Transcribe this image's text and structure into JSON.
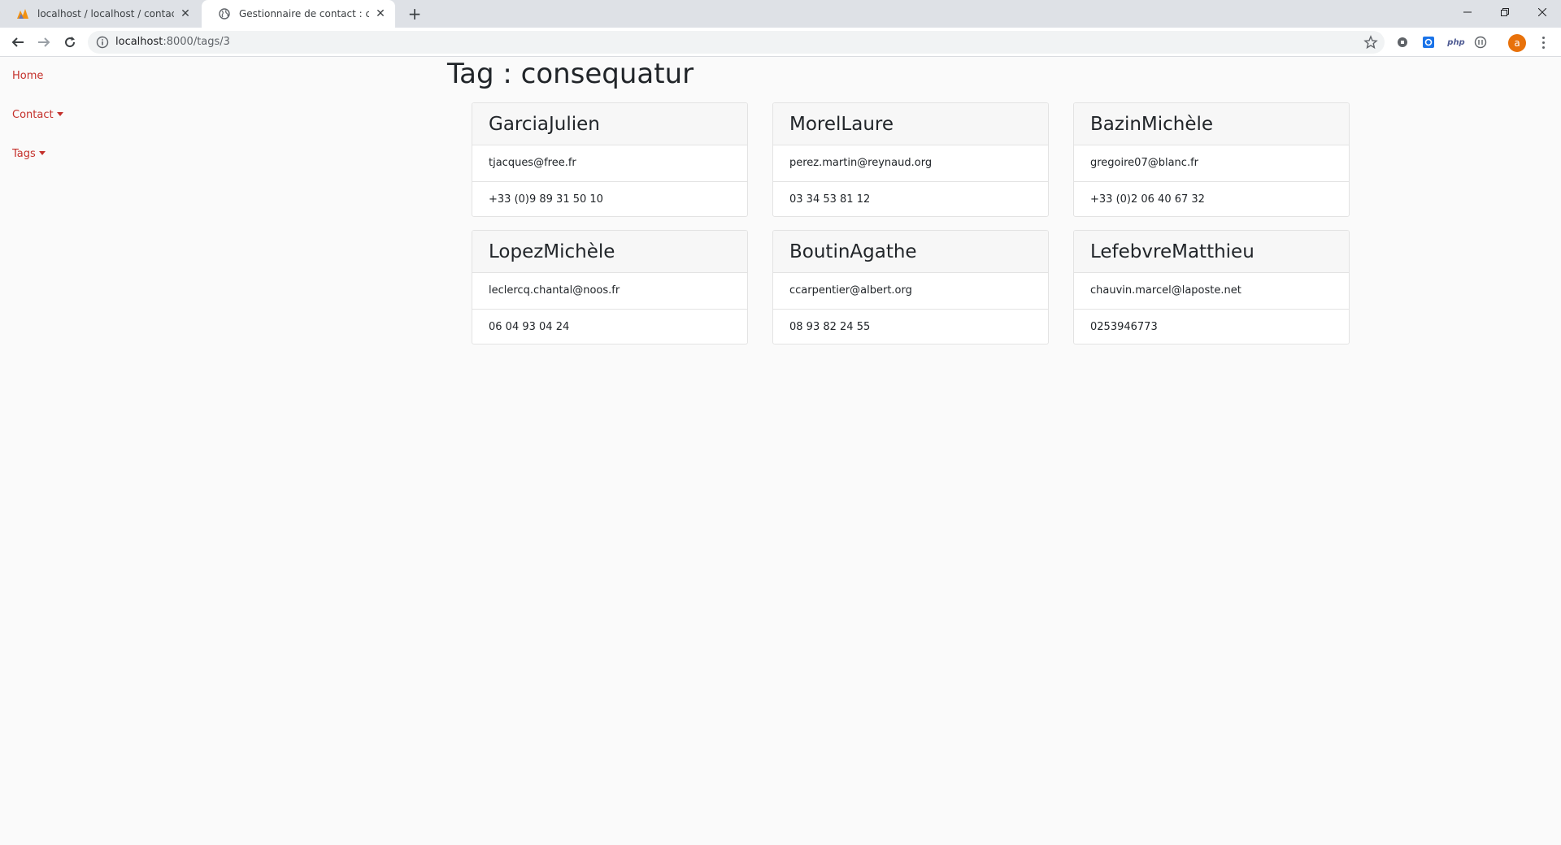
{
  "browser": {
    "tabs": [
      {
        "title": "localhost / localhost / contact / p"
      },
      {
        "title": "Gestionnaire de contact : conseq"
      }
    ],
    "new_tab": "+",
    "url_host": "localhost",
    "url_path": ":8000/tags/3",
    "avatar_letter": "a",
    "php_badge": "php"
  },
  "sidebar": {
    "home": "Home",
    "contact": "Contact",
    "tags": "Tags"
  },
  "page": {
    "title": "Tag : consequatur"
  },
  "contacts": [
    {
      "name": "GarciaJulien",
      "email": "tjacques@free.fr",
      "phone": "+33 (0)9 89 31 50 10"
    },
    {
      "name": "MorelLaure",
      "email": "perez.martin@reynaud.org",
      "phone": "03 34 53 81 12"
    },
    {
      "name": "BazinMichèle",
      "email": "gregoire07@blanc.fr",
      "phone": "+33 (0)2 06 40 67 32"
    },
    {
      "name": "LopezMichèle",
      "email": "leclercq.chantal@noos.fr",
      "phone": "06 04 93 04 24"
    },
    {
      "name": "BoutinAgathe",
      "email": "ccarpentier@albert.org",
      "phone": "08 93 82 24 55"
    },
    {
      "name": "LefebvreMatthieu",
      "email": "chauvin.marcel@laposte.net",
      "phone": "0253946773"
    }
  ],
  "colors": {
    "link": "#c4302b",
    "card_header_bg": "#f7f7f7",
    "page_bg": "#fafafa"
  }
}
